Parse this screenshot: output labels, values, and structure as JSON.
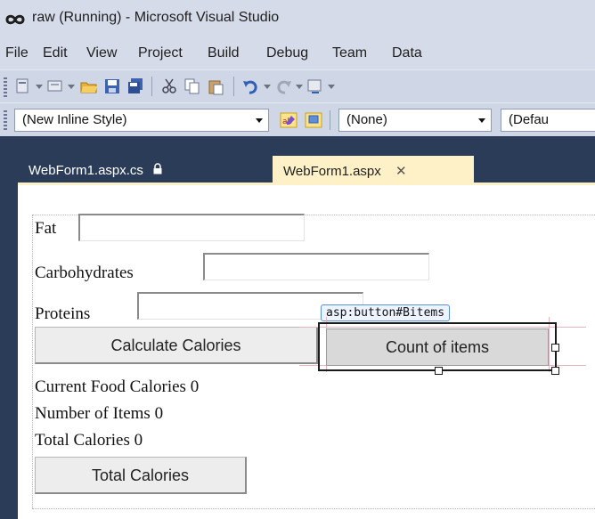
{
  "window": {
    "title": "raw (Running) - Microsoft Visual Studio"
  },
  "menu": {
    "items": [
      "File",
      "Edit",
      "View",
      "Project",
      "Build",
      "Debug",
      "Team",
      "Data"
    ]
  },
  "toolbar2": {
    "style_combo": "(New Inline Style)",
    "target_combo": "(None)",
    "font_combo": "(Defau"
  },
  "tabs": {
    "inactive": {
      "label": "WebForm1.aspx.cs",
      "icon": "lock-icon"
    },
    "active": {
      "label": "WebForm1.aspx",
      "close": "✕"
    }
  },
  "form": {
    "fat_label": "Fat",
    "carbs_label": "Carbohydrates",
    "proteins_label": "Proteins",
    "calculate_button": "Calculate Calories",
    "count_button": "Count of items",
    "selection_tag": "asp:button#Bitems",
    "current_calories_label": "Current Food Calories",
    "current_calories_value": "0",
    "items_label": "Number of Items",
    "items_value": "0",
    "total_label": "Total Calories",
    "total_value": "0",
    "total_button": "Total Calories"
  },
  "colors": {
    "chrome": "#d6dbe9",
    "tab_area": "#2b3c59",
    "active_tab": "#fff1c7",
    "selection_tag_border": "#5b8fd6"
  }
}
